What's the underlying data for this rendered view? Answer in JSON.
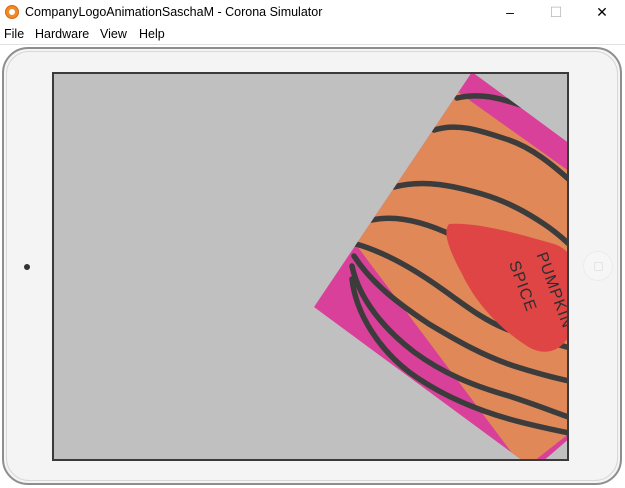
{
  "window": {
    "title": "CompanyLogoAnimationSaschaM - Corona Simulator",
    "minimize_glyph": "–",
    "maximize_glyph": "☐",
    "close_glyph": "✕"
  },
  "menu": {
    "items": [
      "File",
      "Hardware",
      "View",
      "Help"
    ]
  },
  "logo": {
    "text_line1": "PUMPKIN",
    "text_line2": "SPICE"
  },
  "colors": {
    "screen_background": "#c0c0c0",
    "logo_border": "#d8409a",
    "logo_fill": "#e08858",
    "stripe": "#3c3c3c",
    "accent_shape": "#e04545",
    "app_icon": "#f08a24"
  },
  "icons": {
    "app": "corona-simulator-icon",
    "camera": "camera-dot",
    "home": "home-button"
  }
}
